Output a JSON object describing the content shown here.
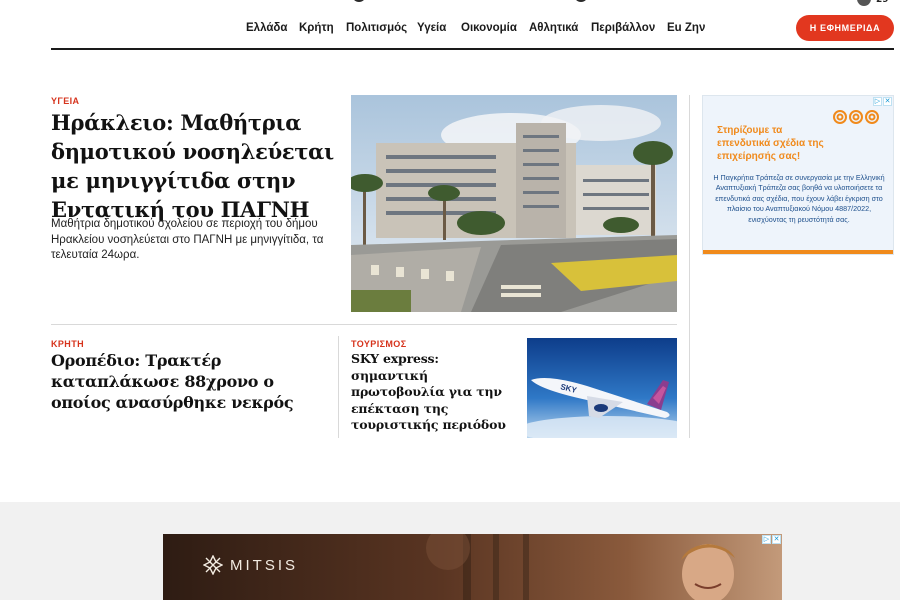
{
  "header": {
    "weather_temp": "29",
    "nav": [
      {
        "label": "Ελλάδα"
      },
      {
        "label": "Κρήτη"
      },
      {
        "label": "Πολιτισμός"
      },
      {
        "label": "Υγεία"
      },
      {
        "label": "Οικονομία"
      },
      {
        "label": "Αθλητικά"
      },
      {
        "label": "Περιβάλλον"
      },
      {
        "label": "Eu Ζην"
      }
    ],
    "newspaper_button": "Η ΕΦΗΜΕΡΙΔΑ"
  },
  "lead": {
    "kicker": "ΥΓΕΙΑ",
    "title": "Ηράκλειο: Μαθήτρια δημοτικού νοσηλεύεται με μηνιγγίτιδα στην Εντατική του ΠΑΓΝΗ",
    "summary": "Μαθήτρια δημοτικού σχολείου σε περιοχή του δήμου Ηρακλείου νοσηλεύεται στο ΠΑΓΝΗ με μηνιγγίτιδα, τα τελευταία 24ωρα."
  },
  "story2": {
    "kicker": "ΚΡΗΤΗ",
    "title": "Οροπέδιο: Τρακτέρ καταπλάκωσε 88χρονο ο οποίος ανασύρθηκε νεκρός"
  },
  "story3": {
    "kicker": "ΤΟΥΡΙΣΜΟΣ",
    "title": "SKY express: σημαντική πρωτοβουλία για την επέκταση της τουριστικής περιόδου",
    "plane_livery": "SKY"
  },
  "side_ad": {
    "headline": "Στηρίζουμε τα επενδυτικά σχέδια της επιχείρησής σας!",
    "body": "Η Παγκρήτια Τράπεζα σε συνεργασία με την Ελληνική Αναπτυξιακή Τράπεζα σας βοηθά να υλοποιήσετε τα επενδυτικά σας σχέδια, που έχουν λάβει έγκριση στο πλαίσιο του Αναπτυξιακού Νόμου 4887/2022, ενισχύοντας τη ρευστότητά σας.",
    "adchoice_info": "▷",
    "adchoice_close": "✕",
    "accent_color": "#f08a1c",
    "text_color": "#1d4f8c"
  },
  "bottom_ad": {
    "brand": "MITSIS",
    "adchoice_info": "▷",
    "adchoice_close": "✕"
  },
  "colors": {
    "accent": "#e2371f",
    "text": "#121212"
  }
}
